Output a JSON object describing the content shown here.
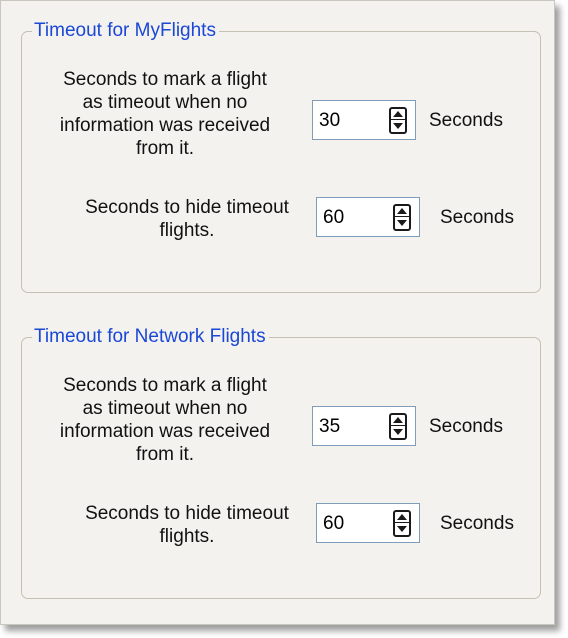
{
  "myflights": {
    "title": "Timeout for MyFlights",
    "mark_timeout": {
      "label_lines": [
        "Seconds to mark a flight",
        "as timeout when no",
        "information was received",
        "from it."
      ],
      "value": "30",
      "unit": "Seconds"
    },
    "hide_timeout": {
      "label_lines": [
        "Seconds to hide timeout",
        "flights."
      ],
      "value": "60",
      "unit": "Seconds"
    }
  },
  "network": {
    "title": "Timeout for Network Flights",
    "mark_timeout": {
      "label_lines": [
        "Seconds to mark a flight",
        "as timeout when no",
        "information was received",
        "from it."
      ],
      "value": "35",
      "unit": "Seconds"
    },
    "hide_timeout": {
      "label_lines": [
        "Seconds to hide timeout",
        "flights."
      ],
      "value": "60",
      "unit": "Seconds"
    }
  },
  "colors": {
    "group_title": "#1a47d6",
    "panel_background": "#f3f2ee",
    "input_border": "#7f9db9"
  },
  "icons": {
    "spinner": "up-down-arrow-icon"
  }
}
